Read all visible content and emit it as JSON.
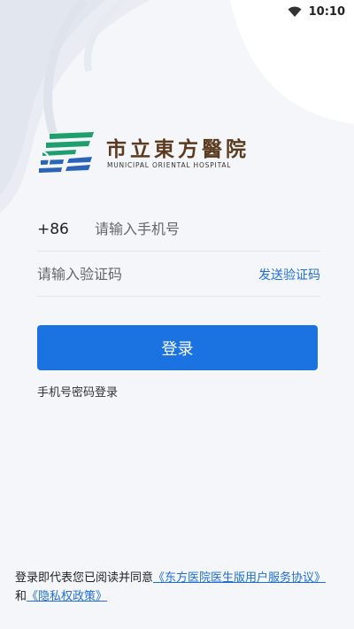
{
  "status_bar": {
    "time": "10:10",
    "wifi_icon": "wifi-icon"
  },
  "logo": {
    "name_cn": "市立東方醫院",
    "name_en": "MUNICIPAL ORIENTAL HOSPITAL",
    "icon": "hospital-logo-mark",
    "colors": {
      "green": "#1f9e6e",
      "blue": "#2a63b8",
      "brown": "#5b3a1e"
    }
  },
  "form": {
    "country_code": "+86",
    "phone_placeholder": "请输入手机号",
    "code_placeholder": "请输入验证码",
    "send_code_label": "发送验证码",
    "login_label": "登录",
    "password_login_label": "手机号密码登录"
  },
  "agreement": {
    "prefix": "登录即代表您已阅读并同意",
    "service_link": "《东方医院医生版用户服务协议》",
    "connector": "和",
    "privacy_link": "《隐私权政策》"
  },
  "colors": {
    "accent": "#1a73e0",
    "link": "#1f6fd6",
    "background": "#f4f6fa"
  }
}
